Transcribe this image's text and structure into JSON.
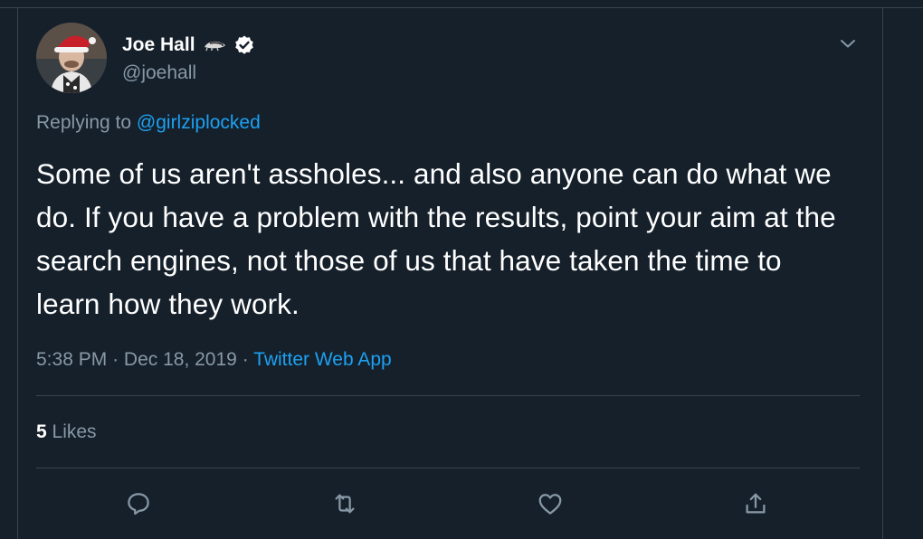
{
  "tweet": {
    "display_name": "Joe Hall",
    "handle": "@joehall",
    "replying_prefix": "Replying to",
    "replying_to": "@girlziplocked",
    "text": "Some of us aren't assholes... and also anyone can do what we do. If you have a problem with the results, point your aim at the search engines, not those of us that have taken the time to learn how they work.",
    "time": "5:38 PM",
    "separator": "·",
    "date": "Dec 18, 2019",
    "source": "Twitter Web App",
    "likes_count": "5",
    "likes_label": "Likes"
  },
  "icons": {
    "verified": "verified-badge-icon",
    "emoji": "badger-emoji-icon",
    "caret": "chevron-down-icon",
    "reply": "reply-icon",
    "retweet": "retweet-icon",
    "like": "heart-icon",
    "share": "share-icon"
  },
  "colors": {
    "background": "#15202b",
    "border": "#38444d",
    "secondary_text": "#8899a6",
    "link": "#1da1f2",
    "text": "#ffffff"
  }
}
